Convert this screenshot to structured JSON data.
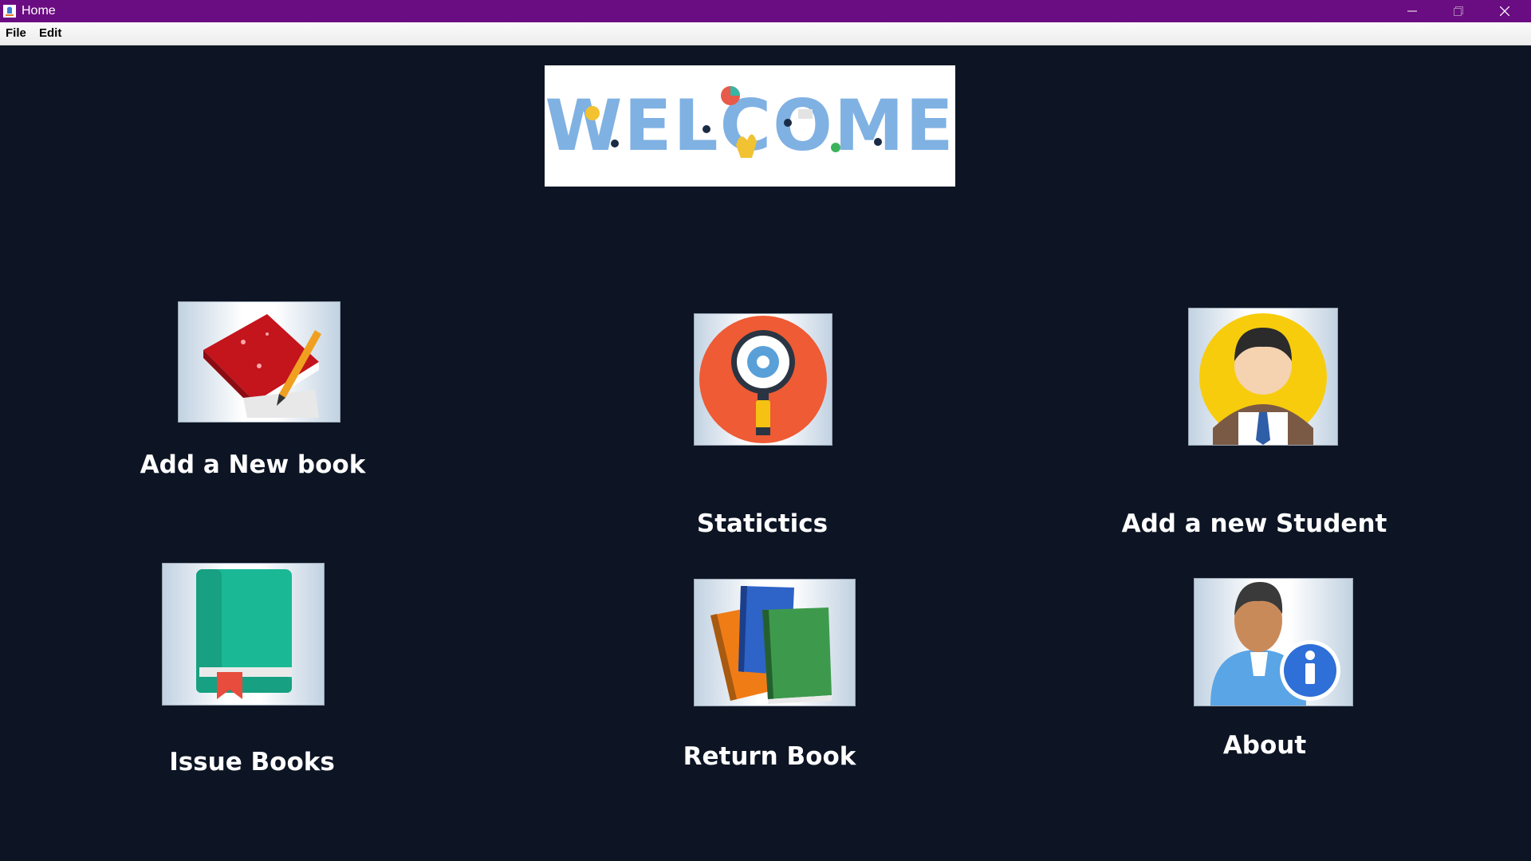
{
  "window": {
    "title": "Home",
    "title_bar_color": "#6b0d82",
    "icons": [
      "app-icon",
      "minimize-icon",
      "maximize-icon",
      "close-icon"
    ]
  },
  "menu": {
    "items": [
      {
        "label": "File"
      },
      {
        "label": "Edit"
      }
    ]
  },
  "banner": {
    "text": "WELCOME"
  },
  "tiles": [
    {
      "label": "Add a New book",
      "icon": "red-book-pencil-icon"
    },
    {
      "label": "Statictics",
      "icon": "magnifier-gear-icon"
    },
    {
      "label": "Add a new Student",
      "icon": "student-avatar-icon"
    },
    {
      "label": "Issue Books",
      "icon": "green-book-icon"
    },
    {
      "label": "Return Book",
      "icon": "book-stack-icon"
    },
    {
      "label": "About",
      "icon": "person-info-icon"
    }
  ],
  "colors": {
    "background": "#0d1524",
    "label_text": "#ffffff",
    "banner_text": "#7fb1e3"
  }
}
